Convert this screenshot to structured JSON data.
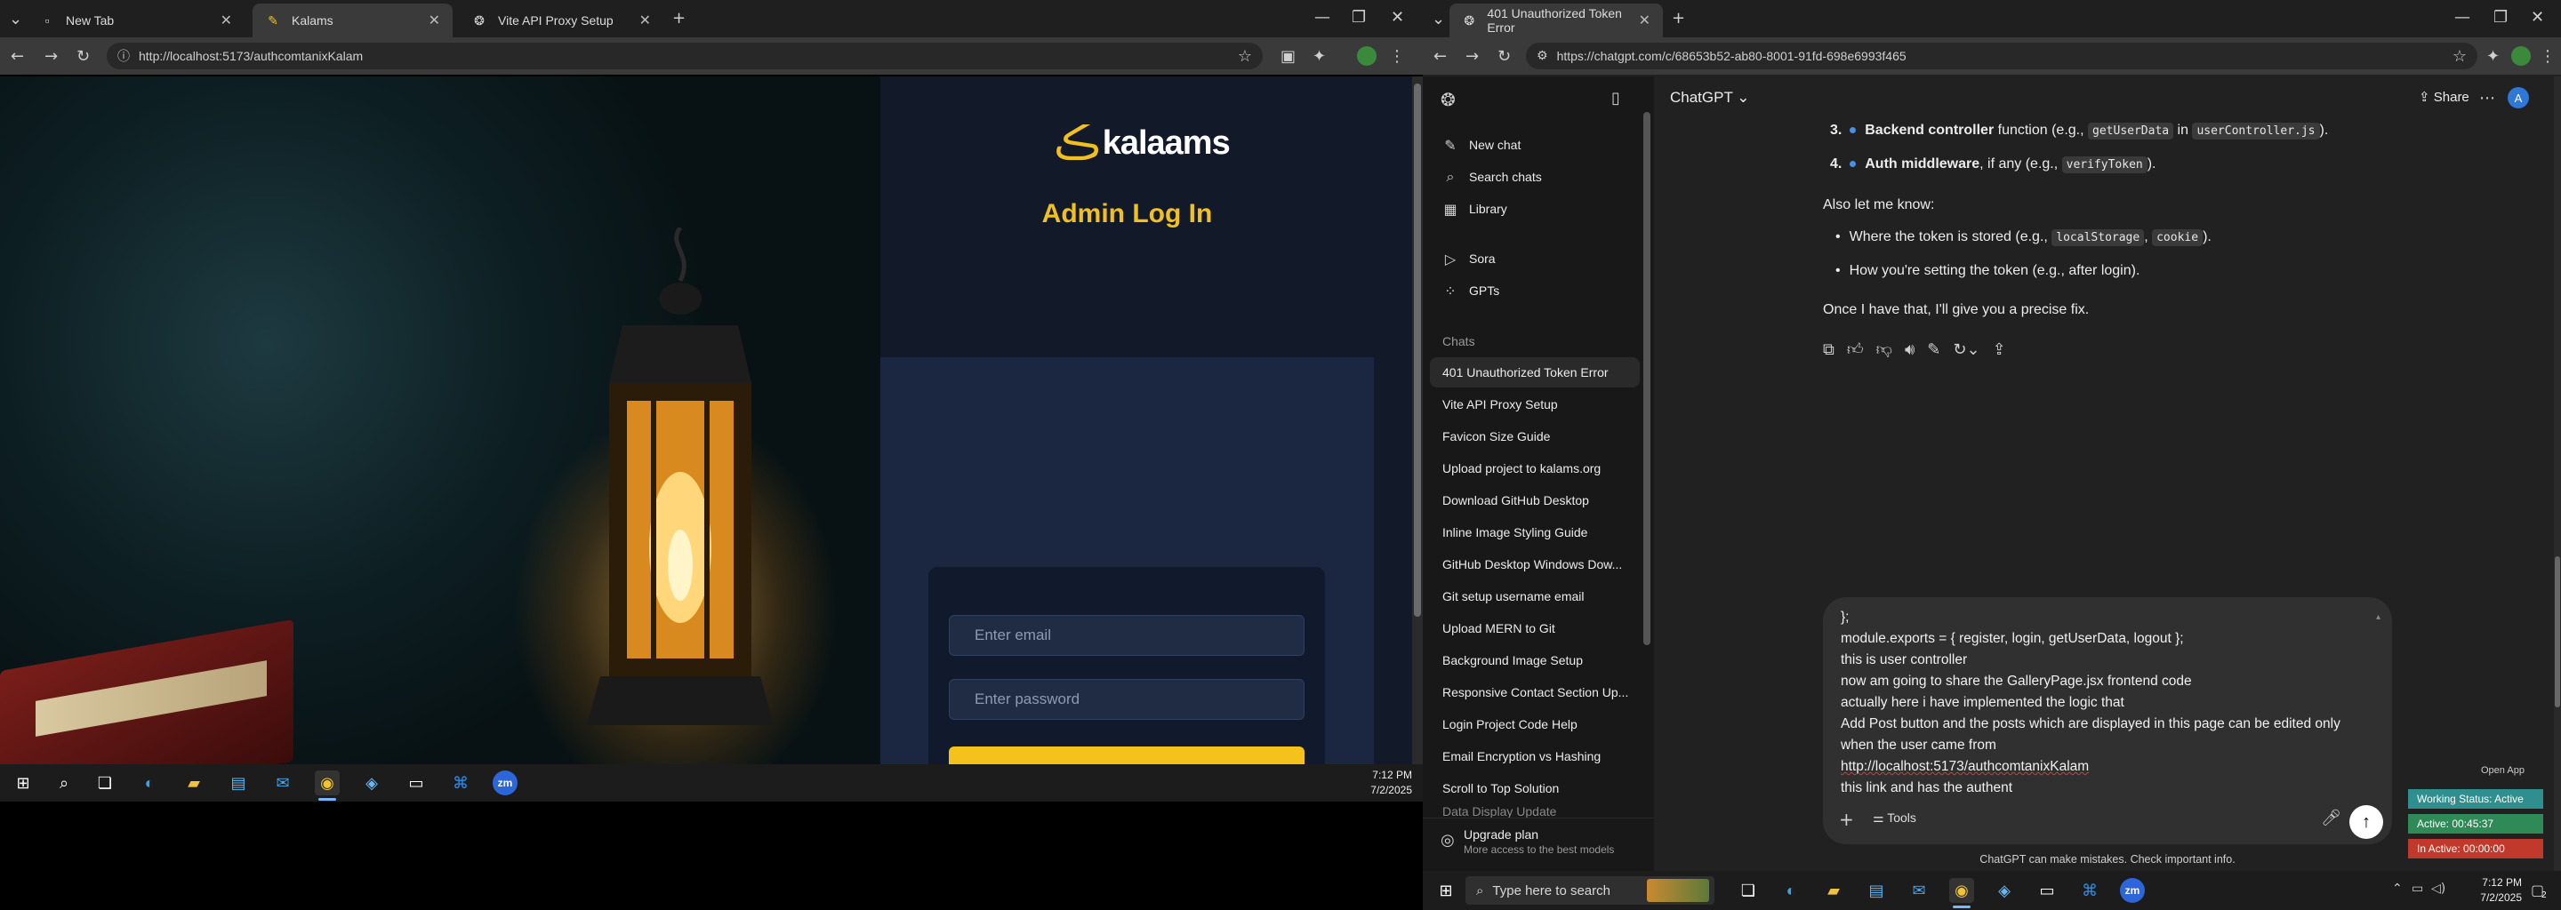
{
  "left_browser": {
    "tabs": [
      {
        "title": "New Tab",
        "icon": "page-icon"
      },
      {
        "title": "Kalams",
        "icon": "feather-icon"
      },
      {
        "title": "Vite API Proxy Setup",
        "icon": "chatgpt-icon"
      }
    ],
    "url": "http://localhost:5173/authcomtanixKalam",
    "site": {
      "logo_text": "kalaams",
      "title": "Admin Log In",
      "email_placeholder": "Enter email",
      "password_placeholder": "Enter password"
    },
    "taskbar": {
      "time": "7:12 PM",
      "date": "7/2/2025"
    }
  },
  "right_browser": {
    "tab": {
      "title": "401 Unauthorized Token Error"
    },
    "url": "https://chatgpt.com/c/68653b52-ab80-8001-91fd-698e6993f465",
    "header": {
      "model": "ChatGPT",
      "share": "Share",
      "avatar": "A"
    },
    "sidebar": {
      "items": [
        {
          "label": "New chat",
          "icon": "compose-icon"
        },
        {
          "label": "Search chats",
          "icon": "search-icon"
        },
        {
          "label": "Library",
          "icon": "library-icon"
        },
        {
          "label": "Sora",
          "icon": "play-icon"
        },
        {
          "label": "GPTs",
          "icon": "grid-icon"
        }
      ],
      "chats_heading": "Chats",
      "chats": [
        "401 Unauthorized Token Error",
        "Vite API Proxy Setup",
        "Favicon Size Guide",
        "Upload project to kalams.org",
        "Download GitHub Desktop",
        "Inline Image Styling Guide",
        "GitHub Desktop Windows Dow...",
        "Git setup username email",
        "Upload MERN to Git",
        "Background Image Setup",
        "Responsive Contact Section Up...",
        "Login Project Code Help",
        "Email Encryption vs Hashing",
        "Scroll to Top Solution",
        "Data Display Update"
      ],
      "upgrade_title": "Upgrade plan",
      "upgrade_sub": "More access to the best models"
    },
    "message": {
      "item3_num": "3.",
      "item3_bold": "Backend controller",
      "item3_mid": " function (e.g., ",
      "item3_code1": "getUserData",
      "item3_in": " in ",
      "item3_code2": "userController.js",
      "item3_end": ").",
      "item4_num": "4.",
      "item4_bold": "Auth middleware",
      "item4_mid": ", if any (e.g., ",
      "item4_code": "verifyToken",
      "item4_end": ").",
      "also": "Also let me know:",
      "b1_pre": "Where the token is stored (e.g., ",
      "b1_code1": "localStorage",
      "b1_sep": ", ",
      "b1_code2": "cookie",
      "b1_end": ").",
      "b2": "How you're setting the token (e.g., after login).",
      "closing": "Once I have that, I'll give you a precise fix."
    },
    "composer": {
      "lines": [
        "};",
        "module.exports = { register, login, getUserData, logout };",
        "this is user controller",
        "now am going to share the GalleryPage.jsx frontend code",
        "actually here i have implemented the logic that",
        "Add Post button and the posts which are displayed in this page can be edited only",
        "when  the user came from",
        "http://localhost:5173/authcomtanixKalam",
        "this link and has the authent"
      ],
      "tools": "Tools"
    },
    "disclaimer": "ChatGPT can make mistakes. Check important info.",
    "status_panel": {
      "open_app": "Open App",
      "working": "Working Status: Active",
      "active": "Active: 00:45:37",
      "inactive": "In Active: 00:00:00",
      "colors": {
        "working": "#2f8f8f",
        "active": "#2e8b57",
        "inactive": "#c0392b"
      }
    },
    "taskbar": {
      "search_placeholder": "Type here to search",
      "time": "7:12 PM",
      "date": "7/2/2025",
      "badge": "2"
    }
  }
}
